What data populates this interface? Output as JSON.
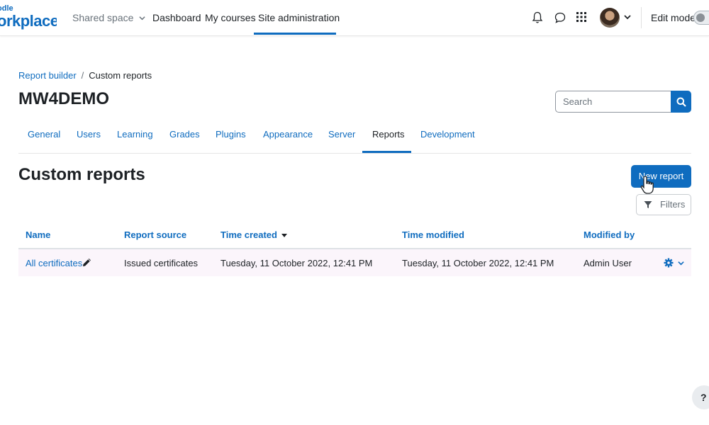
{
  "brand": {
    "logo_top": "odle",
    "logo_main": "orkplace"
  },
  "nav": {
    "shared_space": "Shared space",
    "dashboard": "Dashboard",
    "my_courses": "My courses",
    "site_admin": "Site administration",
    "edit_mode": "Edit mode"
  },
  "breadcrumb": {
    "parent": "Report builder",
    "separator": "/",
    "current": "Custom reports"
  },
  "page": {
    "title": "MW4DEMO",
    "heading": "Custom reports"
  },
  "search": {
    "placeholder": "Search"
  },
  "tabs": [
    "General",
    "Users",
    "Learning",
    "Grades",
    "Plugins",
    "Appearance",
    "Server",
    "Reports",
    "Development"
  ],
  "active_tab": "Reports",
  "actions": {
    "new_report": "New report",
    "filters": "Filters"
  },
  "table": {
    "headers": [
      "Name",
      "Report source",
      "Time created",
      "Time modified",
      "Modified by"
    ],
    "rows": [
      {
        "name": "All certificates",
        "source": "Issued certificates",
        "created": "Tuesday, 11 October 2022, 12:41 PM",
        "modified": "Tuesday, 11 October 2022, 12:41 PM",
        "modified_by": "Admin User"
      }
    ]
  },
  "help": "?",
  "colors": {
    "primary": "#0f6cbf",
    "row_highlight": "#fbf5fb"
  },
  "icons": [
    "bell-icon",
    "chat-icon",
    "apps-grid-icon",
    "chevron-down-icon",
    "search-icon",
    "filter-icon",
    "pencil-icon",
    "gear-icon",
    "help-icon"
  ]
}
